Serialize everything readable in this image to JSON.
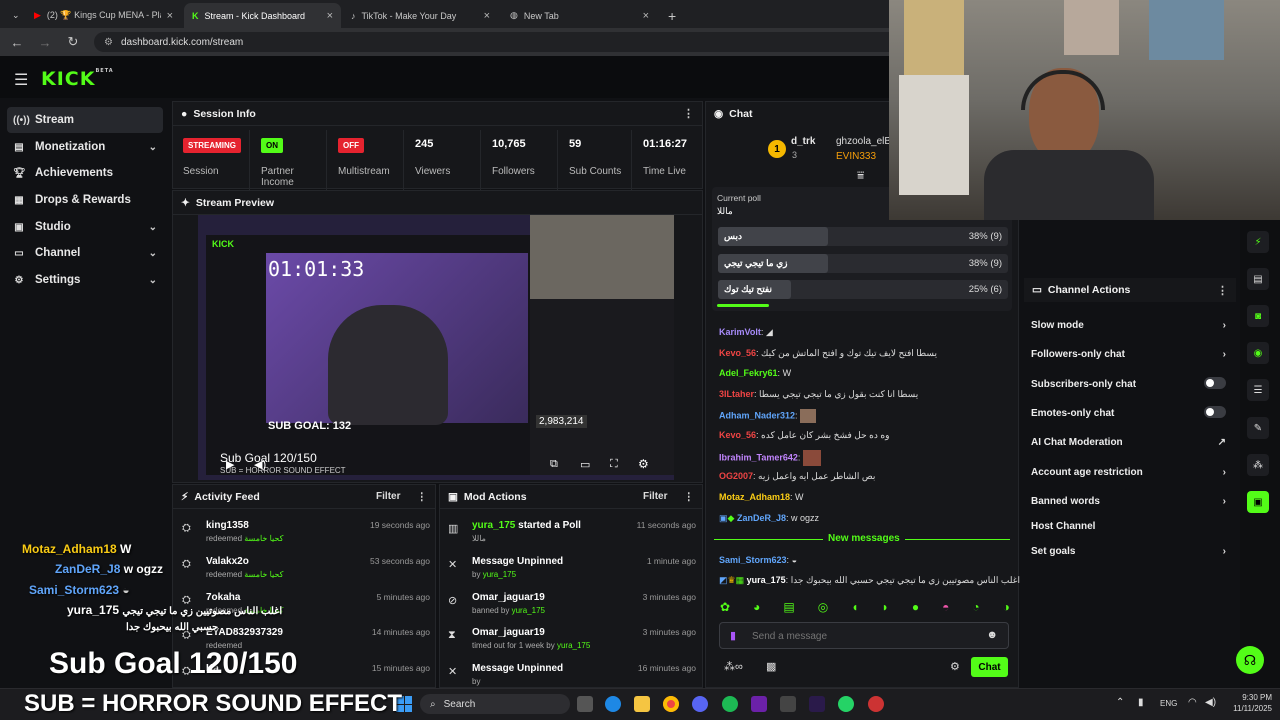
{
  "browser": {
    "tabs": [
      {
        "label": "(2) 🏆 Kings Cup MENA - Playo"
      },
      {
        "label": "Stream - Kick Dashboard"
      },
      {
        "label": "TikTok - Make Your Day"
      },
      {
        "label": "New Tab"
      }
    ],
    "url": "dashboard.kick.com/stream"
  },
  "kick": {
    "logo": "KICK",
    "beta": "BETA"
  },
  "sidebar": {
    "items": [
      {
        "label": "Stream"
      },
      {
        "label": "Monetization"
      },
      {
        "label": "Achievements"
      },
      {
        "label": "Drops & Rewards"
      },
      {
        "label": "Studio"
      },
      {
        "label": "Channel"
      },
      {
        "label": "Settings"
      }
    ]
  },
  "session": {
    "title": "Session Info",
    "cells": [
      {
        "value": "STREAMING",
        "label": "Session"
      },
      {
        "value": "ON",
        "label": "Partner Income"
      },
      {
        "value": "OFF",
        "label": "Multistream"
      },
      {
        "value": "245",
        "label": "Viewers"
      },
      {
        "value": "10,765",
        "label": "Followers"
      },
      {
        "value": "59",
        "label": "Sub Counts"
      },
      {
        "value": "01:16:27",
        "label": "Time Live"
      }
    ]
  },
  "preview": {
    "title": "Stream Preview",
    "timer": "01:01:33",
    "subgoal_banner": "SUB GOAL: 132",
    "subgoal": "Sub Goal 120/150",
    "count": "2,983,214",
    "horror": "SUB = HORROR SOUND EFFECT"
  },
  "activity": {
    "title": "Activity Feed",
    "filter": "Filter",
    "rows": [
      {
        "name": "king1358",
        "sub": "redeemed",
        "reward": "كحيا خامسة",
        "time": "19 seconds ago"
      },
      {
        "name": "Valakx2o",
        "sub": "redeemed",
        "reward": "كحيا خامسة",
        "time": "53 seconds ago"
      },
      {
        "name": "7okaha",
        "sub": "redeemed",
        "reward": "كحيا خامسة",
        "time": "5 minutes ago"
      },
      {
        "name": "EYAD832937329",
        "sub": "redeemed",
        "reward": "",
        "time": "14 minutes ago"
      },
      {
        "name": "Ka",
        "sub": "",
        "reward": "",
        "time": "15 minutes ago"
      }
    ]
  },
  "mods": {
    "title": "Mod Actions",
    "filter": "Filter",
    "rows": [
      {
        "name": "yura_175",
        "action": "started a Poll",
        "sub": "ماللا",
        "by": "",
        "time": "11 seconds ago"
      },
      {
        "name": "Message Unpinned",
        "action": "",
        "sub": "by",
        "by": "yura_175",
        "time": "1 minute ago"
      },
      {
        "name": "Omar_jaguar19",
        "action": "",
        "sub": "banned by",
        "by": "yura_175",
        "time": "3 minutes ago"
      },
      {
        "name": "Omar_jaguar19",
        "action": "",
        "sub": "timed out for 1 week by",
        "by": "yura_175",
        "time": "3 minutes ago"
      },
      {
        "name": "Message Unpinned",
        "action": "",
        "sub": "by",
        "by": "",
        "time": "16 minutes ago"
      }
    ]
  },
  "chat": {
    "title": "Chat",
    "pinned_users": [
      {
        "name": "d_trk",
        "count": "3"
      },
      {
        "name": "ghzoola_elB"
      },
      {
        "name": "EVIN333"
      }
    ],
    "poll": {
      "label": "Current poll",
      "question": "ماللا",
      "options": [
        {
          "text": "دبس",
          "pct": "38% (9)",
          "fraction": 0.38
        },
        {
          "text": "زي ما تيجي تيجي",
          "pct": "38% (9)",
          "fraction": 0.38
        },
        {
          "text": "نفتح تيك توك",
          "pct": "25% (6)",
          "fraction": 0.25
        }
      ]
    },
    "messages": [
      {
        "user": "KarimVolt",
        "text": "",
        "color": "#a78bfa"
      },
      {
        "user": "Kevo_56",
        "text": "يسطا افتح لايف تيك توك و افتح الماتش من كيك",
        "color": "#ef4444"
      },
      {
        "user": "Adel_Fekry61",
        "text": "W",
        "color": "#53fc18"
      },
      {
        "user": "3ILtaher",
        "text": "يسطا انا كنت بقول زي ما تيجي تيجي يسطا",
        "color": "#ef4444"
      },
      {
        "user": "Adham_Nader312",
        "text": "",
        "color": "#60a5fa"
      },
      {
        "user": "Kevo_56",
        "text": "وه ده حل فشخ بشر كان عامل كده",
        "color": "#ef4444"
      },
      {
        "user": "Ibrahim_Tamer642",
        "text": "",
        "color": "#c084fc"
      },
      {
        "user": "OG2007",
        "text": "بص الشاطر عمل ايه واعمل زيه",
        "color": "#ef4444"
      },
      {
        "user": "Motaz_Adham18",
        "text": "W",
        "color": "#facc15"
      },
      {
        "user": "ZanDeR_J8",
        "text": "w ogzz",
        "color": "#60a5fa"
      }
    ],
    "new_messages": "New messages",
    "after": [
      {
        "user": "Sami_Storm623",
        "text": "",
        "color": "#60a5fa"
      },
      {
        "user": "yura_175",
        "text": "اغلب الناس مصوتيين زي ما تيجي تيجي حسبي الله بيحبوك جدا",
        "color": "#fff"
      }
    ],
    "input_placeholder": "Send a message",
    "send": "Chat"
  },
  "channel_actions": {
    "title": "Channel Actions",
    "items": [
      {
        "label": "Slow mode",
        "kind": "chevron"
      },
      {
        "label": "Followers-only chat",
        "kind": "chevron"
      },
      {
        "label": "Subscribers-only chat",
        "kind": "toggle"
      },
      {
        "label": "Emotes-only chat",
        "kind": "toggle"
      },
      {
        "label": "AI Chat Moderation",
        "kind": "external"
      },
      {
        "label": "Account age restriction",
        "kind": "chevron"
      },
      {
        "label": "Banned words",
        "kind": "chevron"
      },
      {
        "label": "Host Channel",
        "kind": "none"
      },
      {
        "label": "Set goals",
        "kind": "chevron"
      }
    ]
  },
  "overlay": {
    "chat": [
      {
        "user": "Motaz_Adham18",
        "text": "W"
      },
      {
        "user": "ZanDeR_J8",
        "text": "w ogzz"
      },
      {
        "user": "Sami_Storm623",
        "text": ""
      },
      {
        "user": "yura_175",
        "text": "اغلب الناس مصوتيين زي ما تيجي تيجي"
      },
      {
        "user": "",
        "text": "حسبي الله بيحبوك جدا"
      }
    ],
    "subgoal": "Sub Goal 120/150",
    "horror": "SUB = HORROR SOUND EFFECT"
  },
  "taskbar": {
    "search": "Search",
    "lang": "ENG",
    "time": "9:30 PM",
    "date": "11/11/2025"
  },
  "colors": {
    "accent": "#53fc18",
    "danger": "#e5232f",
    "bg": "#101114",
    "panel": "#16171a"
  },
  "icons": [
    "menu-icon",
    "stream-icon",
    "dollar-icon",
    "trophy-icon",
    "gift-icon",
    "studio-icon",
    "channel-icon",
    "gear-icon",
    "more-icon",
    "lightning-icon",
    "search-icon"
  ]
}
